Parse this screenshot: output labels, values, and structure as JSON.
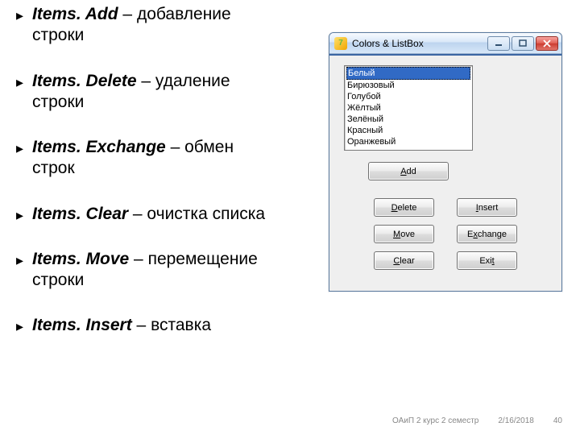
{
  "bullets": [
    {
      "method": "Items. Add",
      "dash": " – ",
      "desc": "добавление",
      "rest": "строки"
    },
    {
      "method": "Items. Delete",
      "dash": " – ",
      "desc": "удаление",
      "rest": "строки"
    },
    {
      "method": "Items. Exchange",
      "dash": " – ",
      "desc": "обмен",
      "rest": "строк"
    },
    {
      "method": "Items. Clear",
      "dash": " – ",
      "desc": "очистка списка",
      "rest": ""
    },
    {
      "method": "Items. Move",
      "dash": " – ",
      "desc": "перемещение",
      "rest": "строки"
    },
    {
      "method": "Items. Insert",
      "dash": " – ",
      "desc": "вставка",
      "rest": ""
    }
  ],
  "window": {
    "title": "Colors & ListBox",
    "icon_glyph": "7",
    "list": [
      "Белый",
      "Бирюзовый",
      "Голубой",
      "Жёлтый",
      "Зелёный",
      "Красный",
      "Оранжевый"
    ],
    "selected_index": 0,
    "buttons": {
      "add": {
        "u": "A",
        "rest": "dd"
      },
      "delete": {
        "u": "D",
        "rest": "elete"
      },
      "insert": {
        "u": "I",
        "rest": "nsert"
      },
      "move": {
        "u": "M",
        "rest": "ove"
      },
      "exchange": {
        "pre": "E",
        "u": "x",
        "rest": "change"
      },
      "clear": {
        "u": "C",
        "rest": "lear"
      },
      "exit": {
        "pre": "Exi",
        "u": "t",
        "rest": ""
      }
    }
  },
  "footer": {
    "course": "ОАиП 2 курс 2 семестр",
    "date": "2/16/2018",
    "page": "40"
  }
}
